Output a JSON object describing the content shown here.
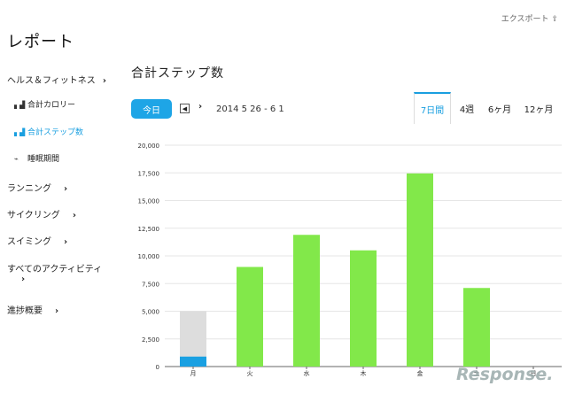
{
  "header": {
    "export_label": "エクスポート",
    "export_icon": "export-icon",
    "page_title": "レポート"
  },
  "sidebar": {
    "health": {
      "label": "ヘルス＆フィットネス",
      "icon": "chevron-right-icon"
    },
    "sub_items": [
      {
        "label": "合計カロリー",
        "icon": "bar-chart-icon",
        "active": false
      },
      {
        "label": "合計ステップ数",
        "icon": "bar-chart-icon",
        "active": true
      },
      {
        "label": "睡眠期間",
        "icon": "pulse-icon",
        "active": false
      }
    ],
    "items": [
      {
        "label": "ランニング"
      },
      {
        "label": "サイクリング"
      },
      {
        "label": "スイミング"
      },
      {
        "label": "すべてのアクティビティ"
      },
      {
        "label": "進捗概要"
      }
    ]
  },
  "main": {
    "section_title": "合計ステップ数",
    "today_label": "今日",
    "date_range": "2014 5 26 - 6 1",
    "tabs": [
      {
        "label": "7日間",
        "active": true
      },
      {
        "label": "4週",
        "active": false
      },
      {
        "label": "6ヶ月",
        "active": false
      },
      {
        "label": "12ヶ月",
        "active": false
      }
    ]
  },
  "chart_data": {
    "type": "bar",
    "categories": [
      "月",
      "火",
      "水",
      "木",
      "金",
      "土",
      "日"
    ],
    "values": [
      5000,
      9000,
      11900,
      10500,
      17450,
      7100,
      0
    ],
    "progress_current": 900,
    "ylim": [
      0,
      20000
    ],
    "yticks": [
      0,
      2500,
      5000,
      7500,
      10000,
      12500,
      15000,
      17500,
      20000
    ],
    "ytick_labels": [
      "0",
      "2,500",
      "5,000",
      "7,500",
      "10,000",
      "12,500",
      "15,000",
      "17,500",
      "20,000"
    ],
    "grid": true,
    "colors": {
      "bar": "#82e84a",
      "goal": "#dddddd",
      "current": "#1aa0e2",
      "grid": "#e6e6e6",
      "axis": "#666666"
    }
  },
  "watermark": "Response."
}
